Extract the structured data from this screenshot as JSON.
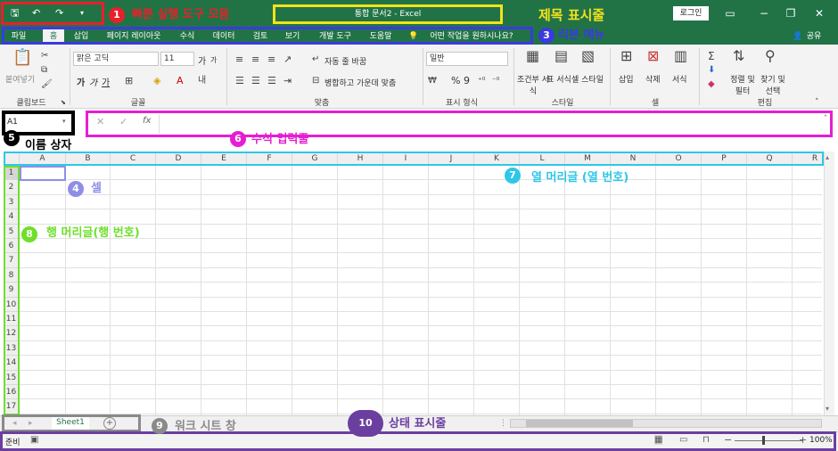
{
  "title_bar": {
    "document_title": "통합 문서2  -  Excel",
    "login_label": "로그인",
    "share_label": "공유"
  },
  "quick_access": {
    "save": "save-icon",
    "undo": "undo-icon",
    "redo": "redo-icon",
    "customize": "customize-icon"
  },
  "tabs": [
    "파일",
    "홈",
    "삽입",
    "페이지 레이아웃",
    "수식",
    "데이터",
    "검토",
    "보기",
    "개발 도구",
    "도움말"
  ],
  "tell_me": "어떤 작업을 원하시나요?",
  "ribbon": {
    "clipboard": {
      "paste": "붙여넣기",
      "group": "클립보드"
    },
    "font": {
      "font_name": "맑은 고딕",
      "font_size": "11",
      "grow": "가",
      "shrink": "가",
      "bold": "가",
      "italic": "가",
      "underline": "가",
      "group": "글꼴"
    },
    "alignment": {
      "wrap_text": "자동 줄 바꿈",
      "merge_center": "병합하고 가운데 맞춤",
      "group": "맞춤"
    },
    "number": {
      "format": "일반",
      "percent": "%",
      "comma": "9",
      "group": "표시 형식"
    },
    "styles": {
      "conditional": "조건부 서식",
      "table": "표 서식",
      "cell": "셀 스타일",
      "group": "스타일"
    },
    "cells": {
      "insert": "삽입",
      "delete": "삭제",
      "format": "서식",
      "group": "셀"
    },
    "editing": {
      "sort": "정렬 및 필터",
      "find": "찾기 및 선택",
      "group": "편집"
    }
  },
  "name_box": "A1",
  "formula_icons": {
    "cancel": "✕",
    "enter": "✓",
    "fx": "fx"
  },
  "columns": [
    "A",
    "B",
    "C",
    "D",
    "E",
    "F",
    "G",
    "H",
    "I",
    "J",
    "K",
    "L",
    "M",
    "N",
    "O",
    "P",
    "Q",
    "R"
  ],
  "rows": [
    "1",
    "2",
    "3",
    "4",
    "5",
    "6",
    "7",
    "8",
    "9",
    "10",
    "11",
    "12",
    "13",
    "14",
    "15",
    "16",
    "17"
  ],
  "sheet_tabs": [
    "Sheet1"
  ],
  "add_sheet": "+",
  "status": {
    "ready": "준비",
    "zoom": "100%",
    "minus": "−",
    "plus": "+"
  },
  "callouts": [
    {
      "num": "1",
      "text": "빠른 실행 도구 모음",
      "color": "#e8202a"
    },
    {
      "num": "",
      "text": "제목 표시줄",
      "color": "#f3e21b"
    },
    {
      "num": "3",
      "text": "리본 메뉴",
      "color": "#3a3ae0"
    },
    {
      "num": "4",
      "text": "셀",
      "color": "#8f8fe6"
    },
    {
      "num": "5",
      "text": "이름 상자",
      "color": "#000000"
    },
    {
      "num": "6",
      "text": "수식 입력줄",
      "color": "#e61ed2"
    },
    {
      "num": "7",
      "text": "열 머리글 (열 번호)",
      "color": "#2ec7e8"
    },
    {
      "num": "8",
      "text": "행 머리글(행 번호)",
      "color": "#6ee02a"
    },
    {
      "num": "9",
      "text": "워크 시트 창",
      "color": "#8a8a8a"
    },
    {
      "num": "10",
      "text": "상태 표시줄",
      "color": "#6b3fa0"
    }
  ]
}
